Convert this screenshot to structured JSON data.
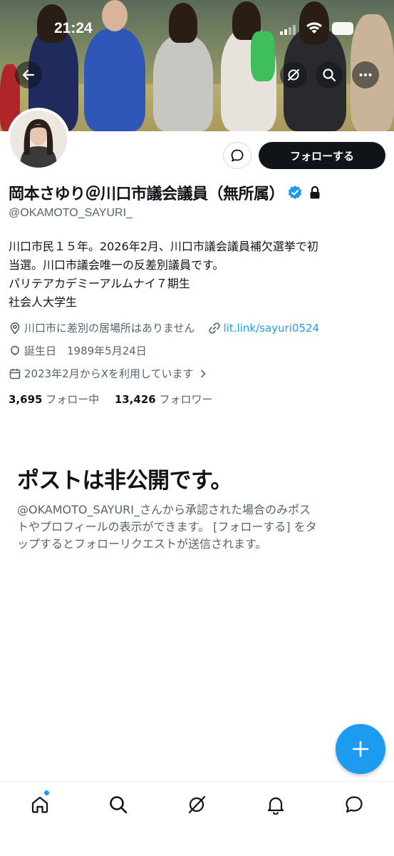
{
  "status_bar": {
    "time": "21:24"
  },
  "profile": {
    "name": "岡本さゆり＠川口市議会議員（無所属）",
    "handle": "@OKAMOTO_SAYURI_",
    "follow_label": "フォローする",
    "bio_lines": [
      "川口市民１５年。2026年2月、川口市議会議員補欠選挙で初",
      "当選。川口市議会唯一の反差別議員です。",
      "パリテアカデミーアルムナイ７期生",
      "社会人大学生"
    ],
    "location": "川口市に差別の居場所はありません",
    "website": "lit.link/sayuri0524",
    "birthday": "誕生日　1989年5月24日",
    "joined": "2023年2月からXを利用しています",
    "following_count": "3,695",
    "following_label": "フォロー中",
    "followers_count": "13,426",
    "followers_label": "フォロワー"
  },
  "private_notice": {
    "title": "ポストは非公開です。",
    "lines": [
      "@OKAMOTO_SAYURI_さんから承認された場合のみポス",
      "トやプロフィールの表示ができます。 [フォローする] をタ",
      "ップするとフォローリクエストが送信されます。"
    ]
  },
  "colors": {
    "accent": "#1d9bf0",
    "text": "#0f1419",
    "secondary": "#536471"
  },
  "icons": {
    "header": [
      "back-arrow-icon",
      "grok-icon",
      "search-icon",
      "more-icon"
    ],
    "nav": [
      "home-icon",
      "search-icon",
      "grok-icon",
      "notifications-icon",
      "messages-icon"
    ]
  }
}
